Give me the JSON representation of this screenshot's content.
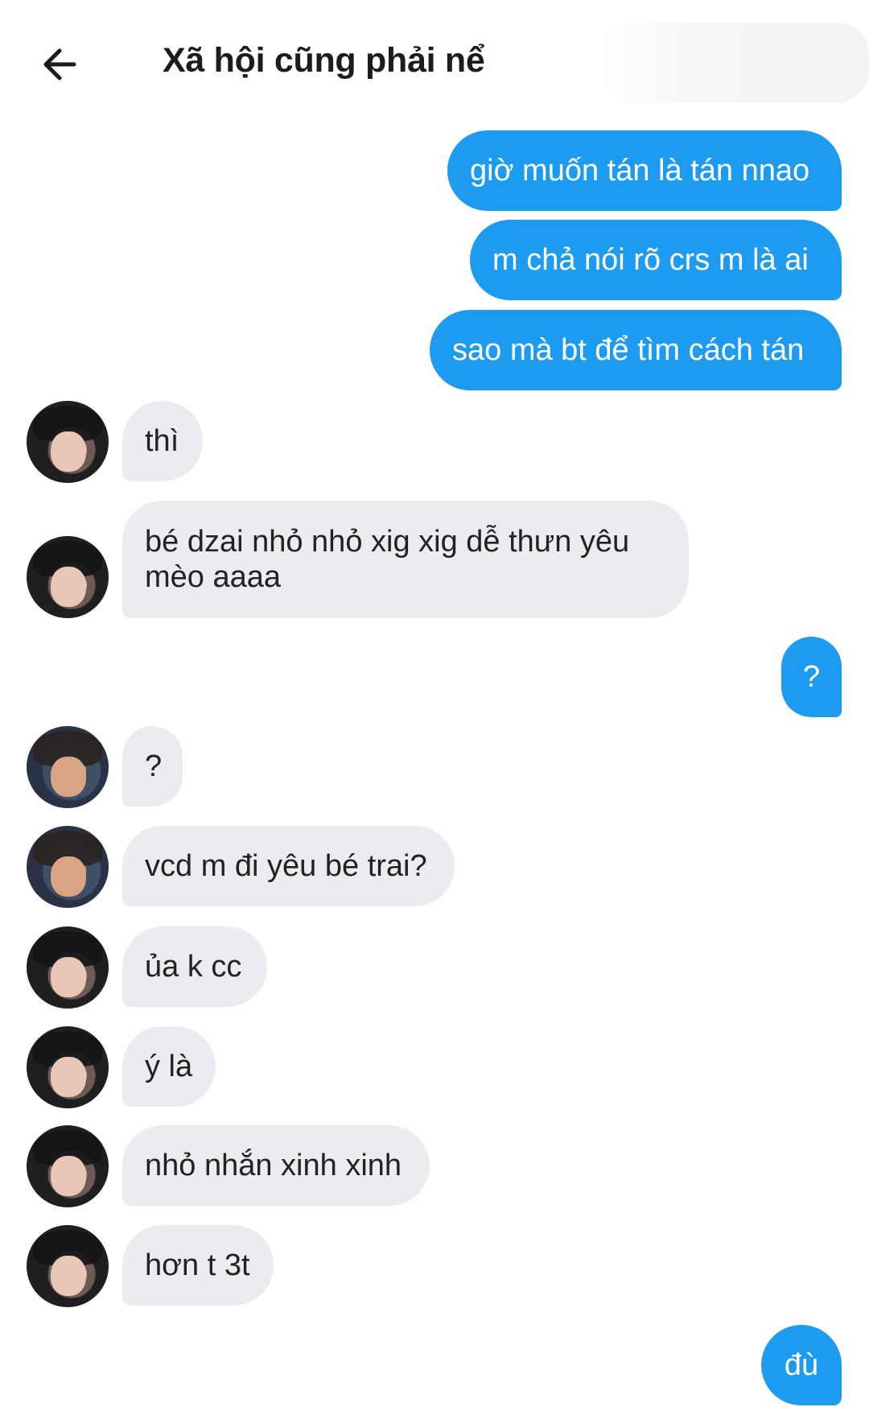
{
  "header": {
    "back_icon": "arrow-left-icon",
    "title": "Xã hội cũng phải nể"
  },
  "colors": {
    "outgoing": "#1d9bf0",
    "incoming": "#eaecef"
  },
  "messages": [
    {
      "dir": "out",
      "text": "giờ muốn tán là tán nnao"
    },
    {
      "dir": "out",
      "text": "m chả nói rõ crs m là ai"
    },
    {
      "dir": "out",
      "text": "sao mà bt để tìm cách tán"
    },
    {
      "dir": "in",
      "avatar": "avatar-a",
      "text": "thì"
    },
    {
      "dir": "in",
      "avatar": "avatar-a",
      "text": "bé dzai nhỏ nhỏ xig xig dễ thưn yêu mèo aaaa"
    },
    {
      "dir": "out",
      "text": "?"
    },
    {
      "dir": "in",
      "avatar": "avatar-b",
      "text": "?"
    },
    {
      "dir": "in",
      "avatar": "avatar-b",
      "text": "vcd m đi yêu bé trai?"
    },
    {
      "dir": "in",
      "avatar": "avatar-a",
      "text": "ủa k cc"
    },
    {
      "dir": "in",
      "avatar": "avatar-a",
      "text": "ý là"
    },
    {
      "dir": "in",
      "avatar": "avatar-a",
      "text": "nhỏ nhắn xinh xinh"
    },
    {
      "dir": "in",
      "avatar": "avatar-a",
      "text": "hơn t 3t"
    },
    {
      "dir": "out",
      "text": "đù"
    }
  ]
}
